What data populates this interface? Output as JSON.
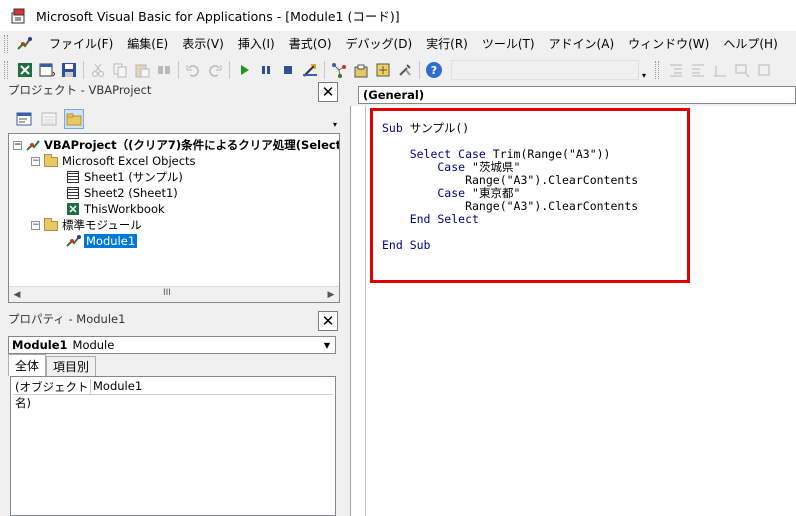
{
  "window": {
    "title": "Microsoft Visual Basic for Applications - [Module1 (コード)]"
  },
  "menu": {
    "items": [
      "ファイル(F)",
      "編集(E)",
      "表示(V)",
      "挿入(I)",
      "書式(O)",
      "デバッグ(D)",
      "実行(R)",
      "ツール(T)",
      "アドイン(A)",
      "ウィンドウ(W)",
      "ヘルプ(H)"
    ]
  },
  "toolbar": {
    "icons": [
      "excel-view-icon",
      "insert-module-icon",
      "save-icon",
      "cut-icon",
      "copy-icon",
      "paste-icon",
      "find-icon",
      "undo-icon",
      "redo-icon",
      "run-icon",
      "break-icon",
      "reset-icon",
      "design-mode-icon",
      "project-explorer-icon",
      "properties-icon",
      "object-browser-icon",
      "toolbox-icon",
      "help-icon"
    ]
  },
  "project": {
    "title": "プロジェクト - VBAProject",
    "tree": {
      "root": "VBAProject（(クリア7)条件によるクリア処理(Select-",
      "excel_objects": "Microsoft Excel Objects",
      "sheet1": "Sheet1 (サンプル)",
      "sheet2": "Sheet2 (Sheet1)",
      "workbook": "ThisWorkbook",
      "modules": "標準モジュール",
      "module1": "Module1"
    },
    "scroll_label": "III"
  },
  "properties": {
    "title": "プロパティ - Module1",
    "object_name": "Module1",
    "object_type": "Module",
    "tabs": [
      "全体",
      "項目別"
    ],
    "row_name": "(オブジェクト名)",
    "row_value": "Module1"
  },
  "code": {
    "object_dropdown": "(General)",
    "lines": [
      {
        "kw": "Sub",
        "rest": " サンプル()"
      },
      {
        "kw": "",
        "rest": ""
      },
      {
        "kw": "    Select Case",
        "rest": " Trim(Range(\"A3\"))"
      },
      {
        "kw": "        Case",
        "rest": " \"茨城県\""
      },
      {
        "kw": "",
        "rest": "            Range(\"A3\").ClearContents"
      },
      {
        "kw": "        Case",
        "rest": " \"東京都\""
      },
      {
        "kw": "",
        "rest": "            Range(\"A3\").ClearContents"
      },
      {
        "kw": "    End Select",
        "rest": ""
      },
      {
        "kw": "",
        "rest": ""
      },
      {
        "kw": "End Sub",
        "rest": ""
      }
    ]
  },
  "colors": {
    "keyword": "#00008b",
    "highlight": "#e00000",
    "selection": "#0078d7"
  }
}
